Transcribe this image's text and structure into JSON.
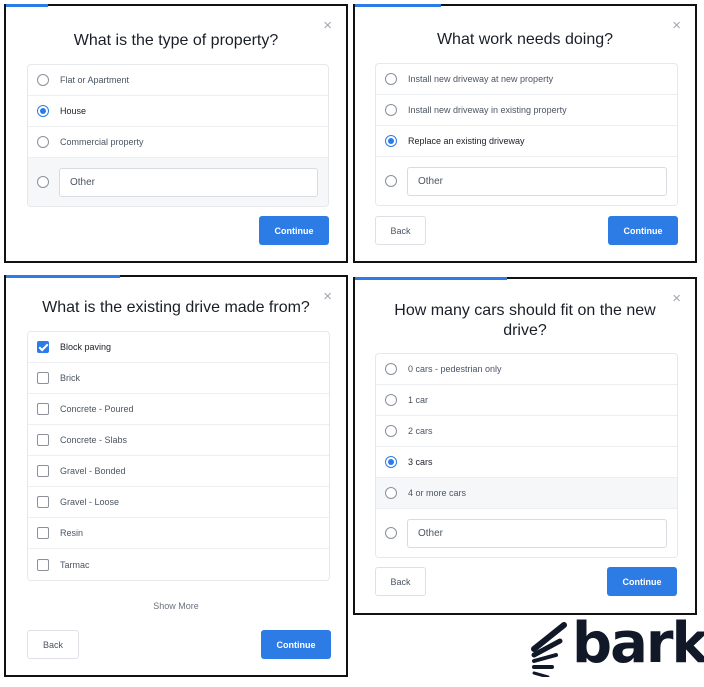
{
  "close_glyph": "×",
  "panel1": {
    "title": "What is the type of property?",
    "options": [
      "Flat or Apartment",
      "House",
      "Commercial property"
    ],
    "selected_index": 1,
    "other_placeholder": "Other",
    "continue_label": "Continue"
  },
  "panel2": {
    "title": "What work needs doing?",
    "options": [
      "Install new driveway at new property",
      "Install new driveway in existing property",
      "Replace an existing driveway"
    ],
    "selected_index": 2,
    "other_placeholder": "Other",
    "back_label": "Back",
    "continue_label": "Continue"
  },
  "panel3": {
    "title": "What is the existing drive made from?",
    "options": [
      "Block paving",
      "Brick",
      "Concrete - Poured",
      "Concrete - Slabs",
      "Gravel - Bonded",
      "Gravel - Loose",
      "Resin",
      "Tarmac"
    ],
    "checked": [
      true,
      false,
      false,
      false,
      false,
      false,
      false,
      false
    ],
    "show_more": "Show More",
    "back_label": "Back",
    "continue_label": "Continue"
  },
  "panel4": {
    "title_line1": "How many cars should fit on the new",
    "title_line2": "drive?",
    "options": [
      "0 cars - pedestrian only",
      "1 car",
      "2 cars",
      "3 cars",
      "4 or more cars"
    ],
    "selected_index": 3,
    "other_placeholder": "Other",
    "back_label": "Back",
    "continue_label": "Continue"
  },
  "logo": {
    "text": "bark",
    "color": "#111827"
  },
  "colors": {
    "accent": "#2d7be5",
    "border": "#111111"
  }
}
